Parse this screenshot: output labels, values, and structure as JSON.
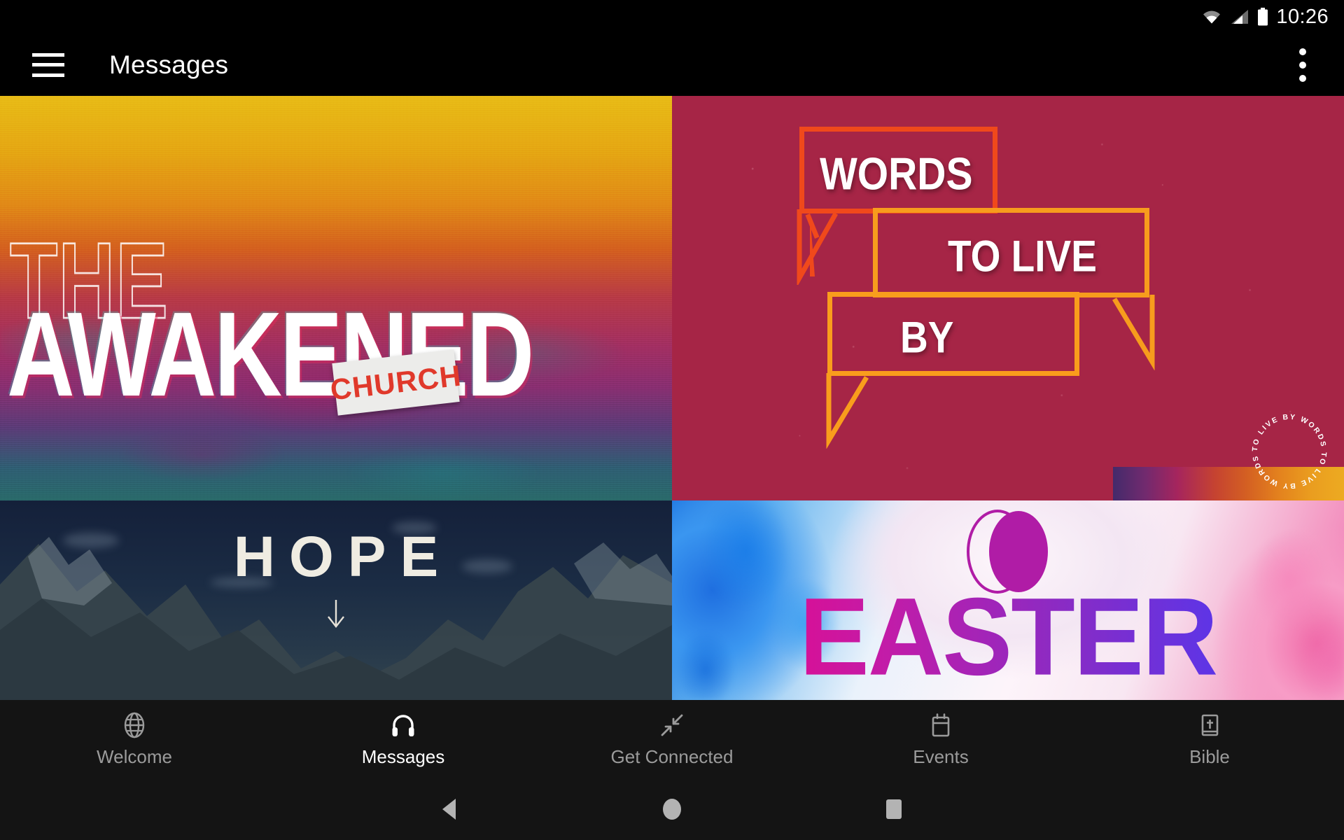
{
  "status_bar": {
    "time": "10:26",
    "icons": [
      "wifi-icon",
      "cellular-signal-icon",
      "battery-icon"
    ]
  },
  "app_bar": {
    "menu_icon": "hamburger-menu-icon",
    "title": "Messages",
    "overflow_icon": "overflow-menu-icon"
  },
  "colors": {
    "app_bar_background": "#000000",
    "tab_bar_background": "#141414",
    "tab_active_text": "#ffffff",
    "tab_inactive_text": "#9b9b9b",
    "card_words_background": "#a62546",
    "card_hope_sky": "#14203a",
    "awakened_church_accent": "#e0392b",
    "easter_gradient_start": "#f4007f",
    "easter_gradient_end": "#4a3df0"
  },
  "message_series": [
    {
      "name": "the-awakened-church",
      "line1": "THE",
      "line2": "AWAKENED",
      "tape_label": "CHURCH"
    },
    {
      "name": "words-to-live-by",
      "bubble1": "WORDS",
      "bubble2": "TO LIVE",
      "bubble3": "BY",
      "circular_text": "TO LIVE BY WORDS TO LIVE BY WORDS "
    },
    {
      "name": "hope",
      "title": "HOPE"
    },
    {
      "name": "easter",
      "title": "EASTER"
    }
  ],
  "tab_bar": {
    "items": [
      {
        "label": "Welcome",
        "icon": "globe-icon",
        "active": false
      },
      {
        "label": "Messages",
        "icon": "headphones-icon",
        "active": true
      },
      {
        "label": "Get Connected",
        "icon": "connect-arrows-icon",
        "active": false
      },
      {
        "label": "Events",
        "icon": "calendar-icon",
        "active": false
      },
      {
        "label": "Bible",
        "icon": "bible-book-icon",
        "active": false
      }
    ]
  },
  "system_nav": {
    "back": "back-triangle-icon",
    "home": "home-circle-icon",
    "recents": "recents-square-icon"
  }
}
